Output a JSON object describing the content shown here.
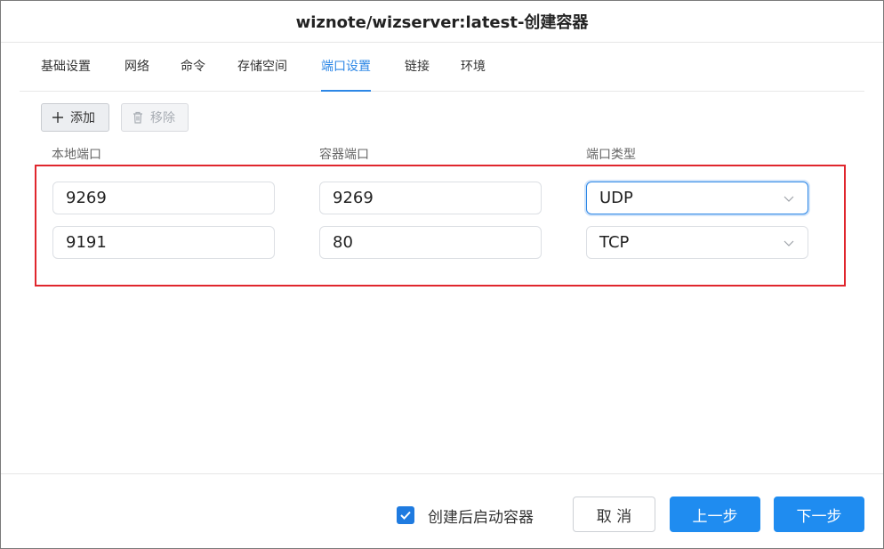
{
  "dialog": {
    "title": "wiznote/wizserver:latest-创建容器"
  },
  "tabs": [
    {
      "label": "基础设置",
      "active": false
    },
    {
      "label": "网络",
      "active": false
    },
    {
      "label": "命令",
      "active": false
    },
    {
      "label": "存储空间",
      "active": false
    },
    {
      "label": "端口设置",
      "active": true
    },
    {
      "label": "链接",
      "active": false
    },
    {
      "label": "环境",
      "active": false
    }
  ],
  "toolbar": {
    "add_label": "添加",
    "remove_label": "移除",
    "remove_disabled": true
  },
  "columns": {
    "local_port": "本地端口",
    "container_port": "容器端口",
    "port_type": "端口类型"
  },
  "rows": [
    {
      "local_port": "9269",
      "container_port": "9269",
      "port_type": "UDP"
    },
    {
      "local_port": "9191",
      "container_port": "80",
      "port_type": "TCP"
    }
  ],
  "footer": {
    "auto_start_label": "创建后启动容器",
    "auto_start_checked": true,
    "cancel_label": "取 消",
    "prev_label": "上一步",
    "next_label": "下一步"
  },
  "colors": {
    "accent": "#2d87e6",
    "primary_button": "#1f8cf0",
    "highlight_border": "#e0262d"
  }
}
